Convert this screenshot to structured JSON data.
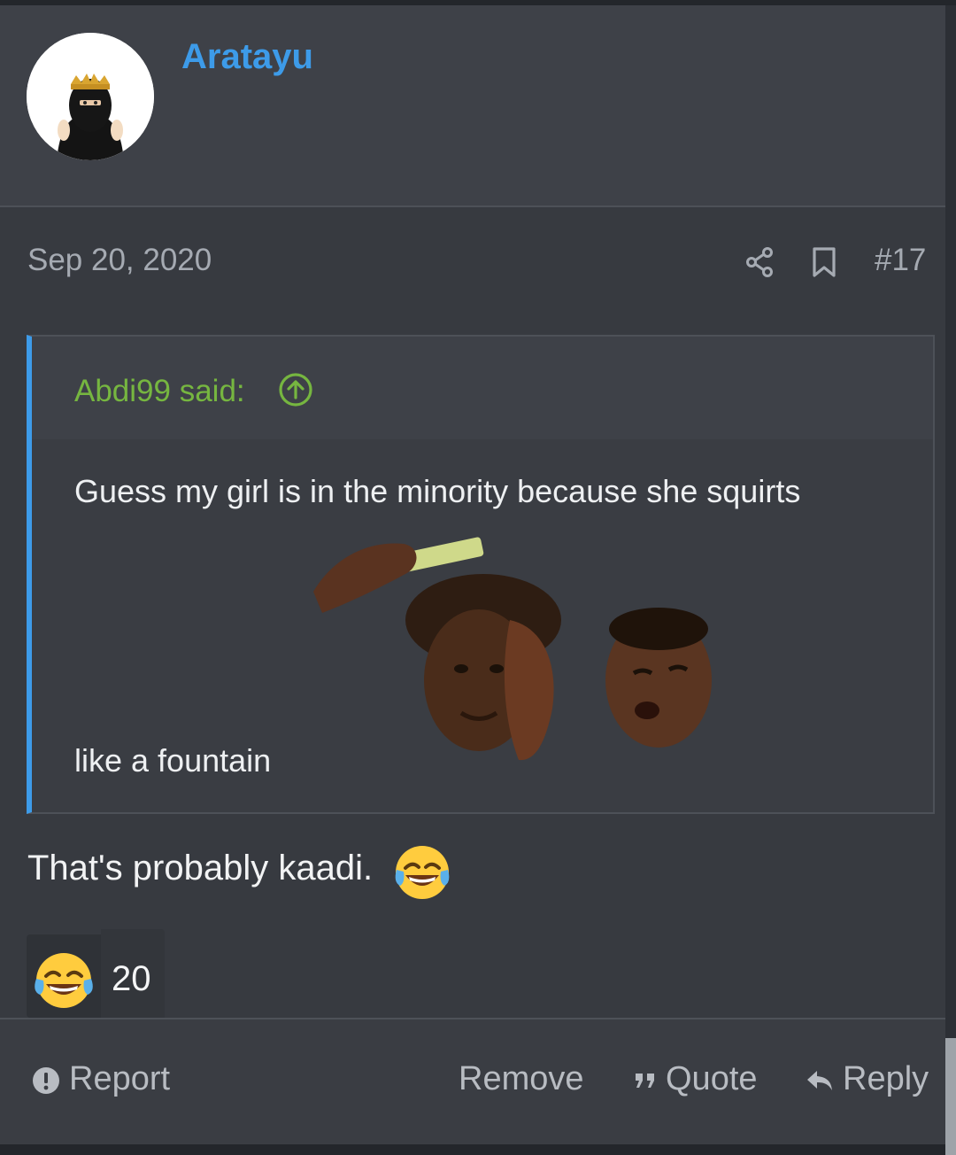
{
  "post": {
    "username": "Aratayu",
    "date": "Sep 20, 2020",
    "post_number": "#17",
    "quote": {
      "author": "Abdi99 said:",
      "line1": "Guess my girl is in the minority because she squirts",
      "line2": "like a fountain"
    },
    "body_text": "That's probably kaadi.",
    "reaction": {
      "emoji": "joy-emoji",
      "count": "20"
    }
  },
  "footer": {
    "report": "Report",
    "remove": "Remove",
    "quote": "Quote",
    "reply": "Reply"
  },
  "colors": {
    "accent_blue": "#3d9be9",
    "quote_author_green": "#76b640",
    "background": "#373a40"
  }
}
